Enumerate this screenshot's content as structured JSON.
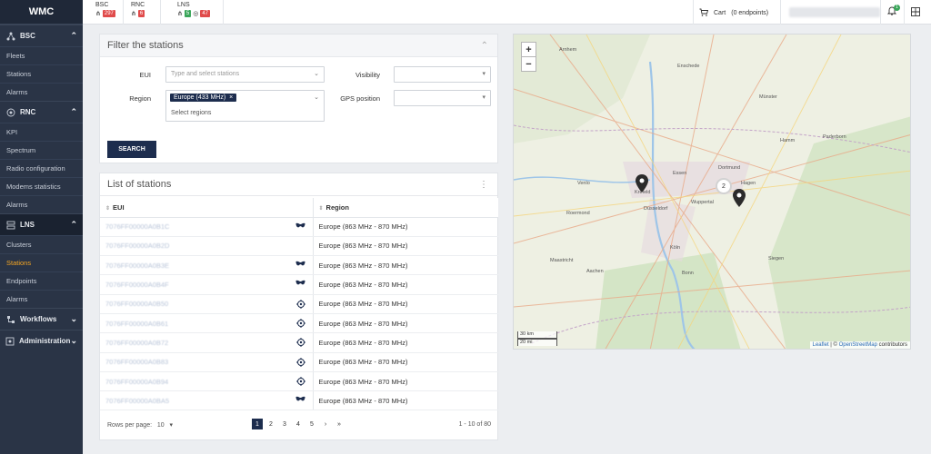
{
  "app": {
    "brand": "WMC"
  },
  "sidebar": {
    "sections": [
      {
        "label": "BSC",
        "items": [
          "Fleets",
          "Stations",
          "Alarms"
        ]
      },
      {
        "label": "RNC",
        "items": [
          "KPI",
          "Spectrum",
          "Radio configuration",
          "Modems statistics",
          "Alarms"
        ]
      },
      {
        "label": "LNS",
        "items": [
          "Clusters",
          "Stations",
          "Endpoints",
          "Alarms"
        ],
        "active_item": "Stations"
      },
      {
        "label": "Workflows",
        "items": []
      },
      {
        "label": "Administration",
        "items": []
      }
    ]
  },
  "topbar": {
    "bsc": {
      "label": "BSC",
      "badge": "297"
    },
    "rnc": {
      "label": "RNC",
      "badge": "6"
    },
    "lns": {
      "label": "LNS",
      "badge_green": "5",
      "badge_red": "47"
    },
    "cart_label": "Cart",
    "cart_count": "(0 endpoints)",
    "notif_count": "1"
  },
  "filter": {
    "title": "Filter the stations",
    "eui_label": "EUI",
    "eui_placeholder": "Type and select stations",
    "visibility_label": "Visibility",
    "region_label": "Region",
    "region_chip": "Europe (433 MHz)",
    "region_placeholder": "Select regions",
    "gps_label": "GPS position",
    "search_label": "SEARCH"
  },
  "list": {
    "title": "List of stations",
    "col_eui": "EUI",
    "col_region": "Region",
    "rows": [
      {
        "eui": "7076FF00000A0B1C",
        "region": "Europe (863 MHz - 870 MHz)",
        "icon": "mask"
      },
      {
        "eui": "7076FF00000A0B2D",
        "region": "Europe (863 MHz - 870 MHz)",
        "icon": ""
      },
      {
        "eui": "7076FF00000A0B3E",
        "region": "Europe (863 MHz - 870 MHz)",
        "icon": "mask"
      },
      {
        "eui": "7076FF00000A0B4F",
        "region": "Europe (863 MHz - 870 MHz)",
        "icon": "mask"
      },
      {
        "eui": "7076FF00000A0B50",
        "region": "Europe (863 MHz - 870 MHz)",
        "icon": "target"
      },
      {
        "eui": "7076FF00000A0B61",
        "region": "Europe (863 MHz - 870 MHz)",
        "icon": "target"
      },
      {
        "eui": "7076FF00000A0B72",
        "region": "Europe (863 MHz - 870 MHz)",
        "icon": "target"
      },
      {
        "eui": "7076FF00000A0B83",
        "region": "Europe (863 MHz - 870 MHz)",
        "icon": "target"
      },
      {
        "eui": "7076FF00000A0B94",
        "region": "Europe (863 MHz - 870 MHz)",
        "icon": "target"
      },
      {
        "eui": "7076FF00000A0BA5",
        "region": "Europe (863 MHz - 870 MHz)",
        "icon": "mask"
      }
    ],
    "rows_per_page_label": "Rows per page:",
    "rows_per_page": "10",
    "pages": [
      "1",
      "2",
      "3",
      "4",
      "5"
    ],
    "next": "›",
    "last": "»",
    "range": "1 - 10 of 80"
  },
  "map": {
    "zoom_in": "+",
    "zoom_out": "−",
    "cluster_count": "2",
    "scale_km": "30 km",
    "scale_mi": "20 mi",
    "attrib_leaflet": "Leaflet",
    "attrib_sep": " | © ",
    "attrib_osm": "OpenStreetMap",
    "attrib_tail": " contributors",
    "labels": [
      "Enschede",
      "Münster",
      "Hamm",
      "Dortmund",
      "Essen",
      "Krefeld",
      "Düsseldorf",
      "Wuppertal",
      "Köln",
      "Bonn",
      "Aachen",
      "Siegen",
      "Hagen",
      "Paderborn",
      "Venlo",
      "Roermond",
      "Maastricht",
      "Arnhem"
    ]
  }
}
